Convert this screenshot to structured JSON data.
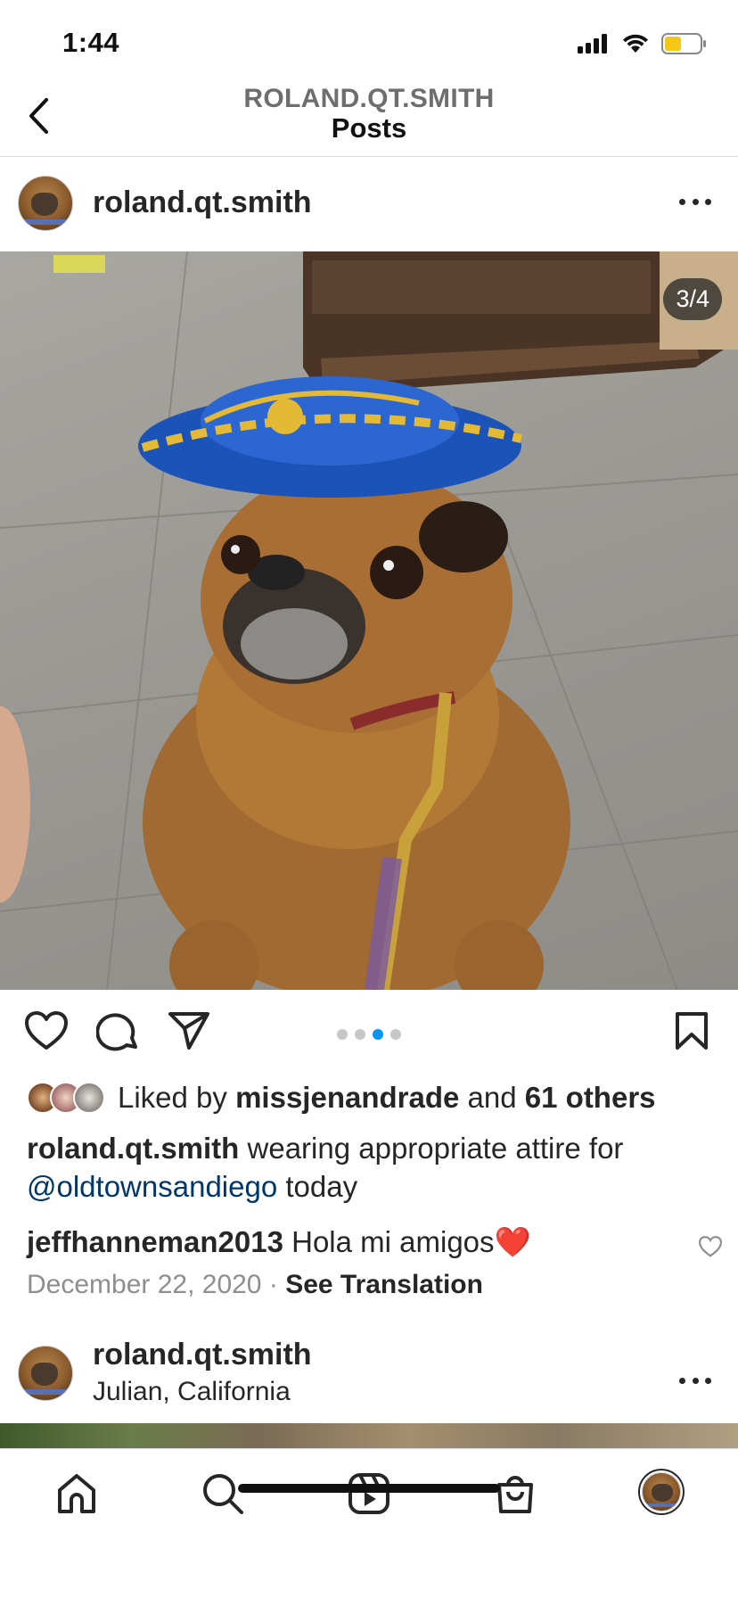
{
  "status": {
    "time": "1:44"
  },
  "header": {
    "username": "ROLAND.QT.SMITH",
    "title": "Posts"
  },
  "post": {
    "username": "roland.qt.smith",
    "media_counter": "3/4",
    "carousel": {
      "total": 4,
      "active": 3
    },
    "likes": {
      "prefix": "Liked by",
      "user": "missjenandrade",
      "middle": "and",
      "others": "61 others"
    },
    "caption": {
      "user": "roland.qt.smith",
      "text": "wearing appropriate attire for",
      "mention": "@oldtownsandiego",
      "suffix": "today"
    },
    "comment": {
      "user": "jeffhanneman2013",
      "text": "Hola mi amigos",
      "emoji": "❤️"
    },
    "date": "December 22, 2020",
    "separator": "·",
    "translate": "See Translation"
  },
  "next_post": {
    "username": "roland.qt.smith",
    "location": "Julian, California"
  },
  "icons": {
    "back": "chevron-left-icon",
    "more": "more-icon",
    "like": "heart-icon",
    "comment": "comment-icon",
    "share": "paper-plane-icon",
    "save": "bookmark-icon",
    "home": "home-icon",
    "search": "search-icon",
    "reels": "reels-icon",
    "shop": "shop-bag-icon"
  },
  "colors": {
    "link": "#00376b",
    "accent": "#0095f6",
    "heart": "#e0142b",
    "muted": "#8e8e8e"
  }
}
